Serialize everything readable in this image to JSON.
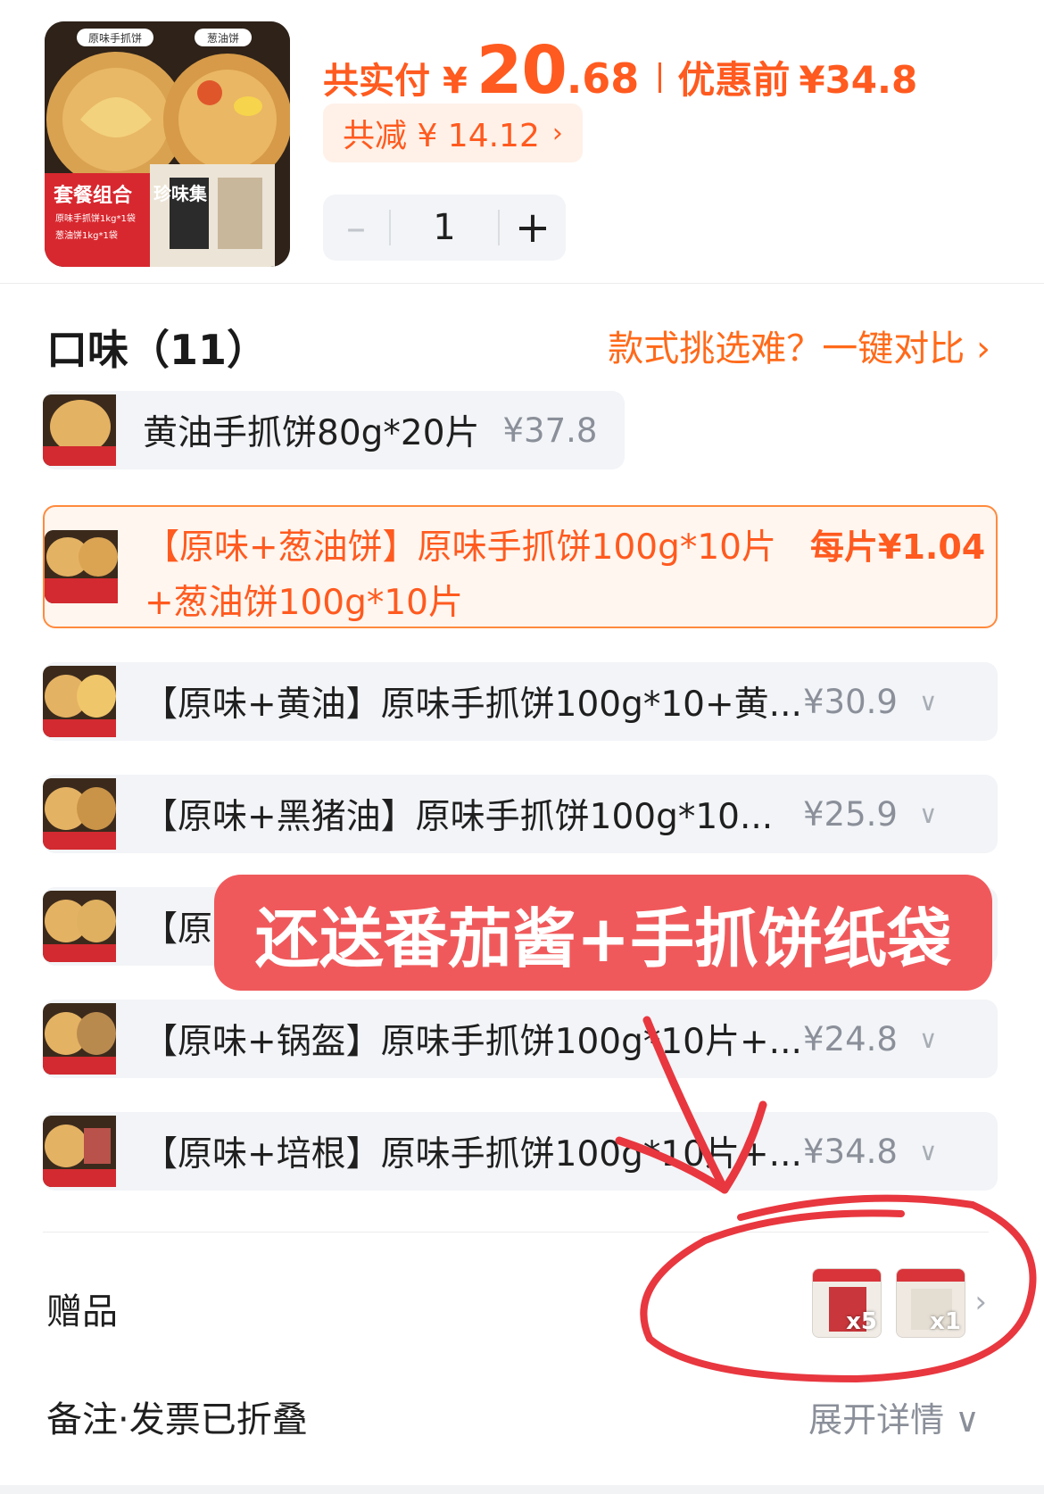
{
  "header": {
    "paid_label": "共实付",
    "currency": "¥",
    "paid_int": "20",
    "paid_dec": ".68",
    "orig_label": "优惠前",
    "orig_price": "¥34.8",
    "discount_text": "共减 ¥ 14.12",
    "discount_chevron": "›",
    "quantity": "1",
    "minus": "–",
    "plus": "+",
    "thumb_badges": [
      "原味手抓饼",
      "葱油饼"
    ],
    "thumb_combo": "套餐组合",
    "thumb_line1": "原味手抓饼1kg*1袋",
    "thumb_line2": "葱油饼1kg*1袋",
    "thumb_brand": "珍味集"
  },
  "flavor": {
    "title": "口味（11）",
    "compare": "款式挑选难？一键对比 ›",
    "options": [
      {
        "name": "黄油手抓饼80g*20片",
        "price": "¥37.8",
        "chevron": ""
      },
      {
        "name": "【原味+葱油饼】原味手抓饼100g*10片",
        "name2": "+葱油饼100g*10片",
        "price": "每片¥1.04",
        "chevron": ""
      },
      {
        "name": "【原味+黄油】原味手抓饼100g*10+黄...",
        "price": "¥30.9",
        "chevron": "∨"
      },
      {
        "name": "【原味+黑猪油】原味手抓饼100g*10...",
        "price": "¥25.9",
        "chevron": "∨"
      },
      {
        "name": "【原",
        "price": "",
        "chevron": ""
      },
      {
        "name": "【原味+锅盔】原味手抓饼100g*10片+...",
        "price": "¥24.8",
        "chevron": "∨"
      },
      {
        "name": "【原味+培根】原味手抓饼100g*10片+...",
        "price": "¥34.8",
        "chevron": "∨"
      }
    ]
  },
  "promo": "还送番茄酱+手抓饼纸袋",
  "gifts": {
    "label": "赠品",
    "items": [
      {
        "count": "x5"
      },
      {
        "count": "x1"
      }
    ],
    "chevron": "›"
  },
  "notes": {
    "label": "备注·发票已折叠",
    "expand": "展开详情 ∨"
  },
  "colors": {
    "accent": "#ff5a1f",
    "promo_bg": "#f0595b",
    "annotation": "#e8373f"
  }
}
